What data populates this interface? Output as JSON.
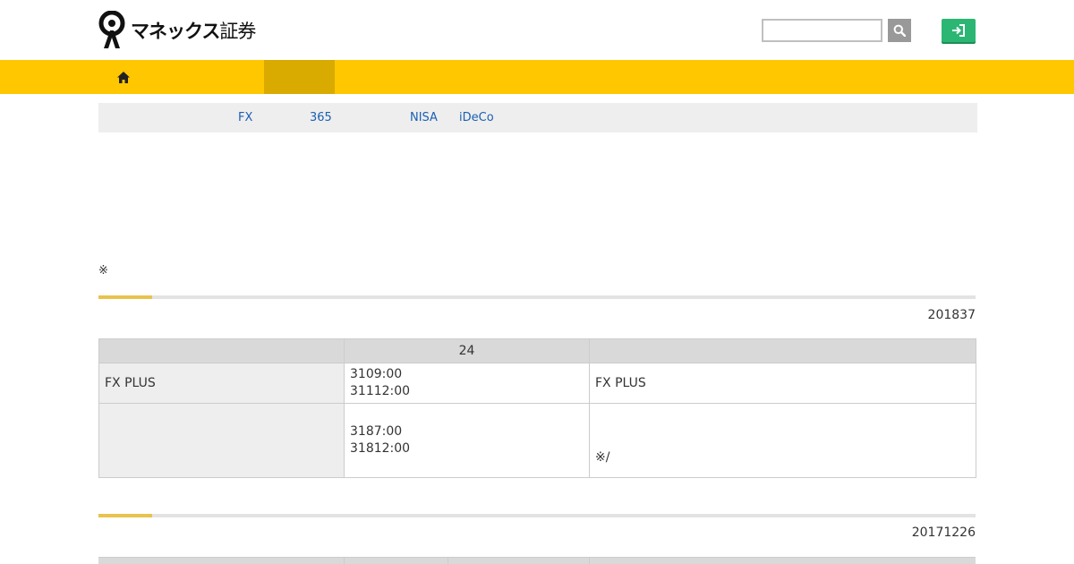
{
  "header": {
    "logo_text": "マネックス",
    "logo_sub": "証券",
    "search_placeholder": "",
    "search_icon": "magnifier-icon",
    "login_icon": "sign-in-icon"
  },
  "nav": {
    "home_icon": "home-icon"
  },
  "subnav": {
    "links": [
      "FX",
      "365",
      "NISA",
      "iDeCo"
    ]
  },
  "note": "※",
  "section1": {
    "date": "201837",
    "headers": [
      "",
      "24",
      ""
    ],
    "rows": [
      {
        "label": "FX PLUS",
        "times": [
          "3109:00",
          "31112:00"
        ],
        "notes": [
          "FX PLUS"
        ]
      },
      {
        "label": "",
        "times": [
          "3187:00",
          "31812:00"
        ],
        "notes": [
          "",
          "",
          "※/"
        ]
      }
    ]
  },
  "section2": {
    "date": "20171226"
  },
  "colors": {
    "nav_yellow": "#ffc700",
    "nav_active": "#d9aa00",
    "login_green": "#2bb673",
    "link_blue": "#1a5fb4",
    "accent_gold": "#e8c34d"
  }
}
